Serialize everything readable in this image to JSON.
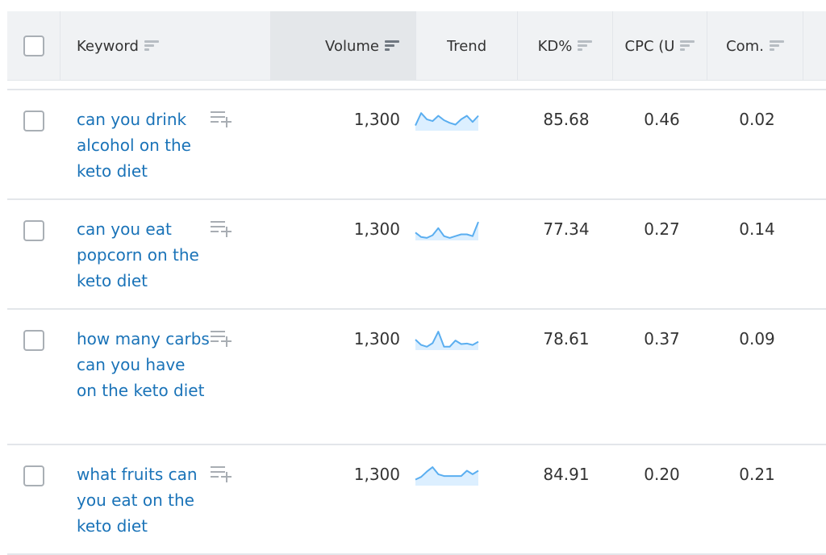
{
  "header": {
    "select_all_checked": false,
    "columns": [
      {
        "key": "keyword",
        "label": "Keyword",
        "sortable": true,
        "sorted": false
      },
      {
        "key": "volume",
        "label": "Volume",
        "sortable": true,
        "sorted": true
      },
      {
        "key": "trend",
        "label": "Trend",
        "sortable": false,
        "sorted": false
      },
      {
        "key": "kd",
        "label": "KD%",
        "sortable": true,
        "sorted": false
      },
      {
        "key": "cpc",
        "label": "CPC (U",
        "sortable": true,
        "sorted": false
      },
      {
        "key": "com",
        "label": "Com.",
        "sortable": true,
        "sorted": false
      }
    ]
  },
  "icons": {
    "sort": "sort-lines-icon",
    "add_to_list": "playlist-add-icon",
    "checkbox": "checkbox-icon"
  },
  "colors": {
    "link": "#1a73b8",
    "trend_line": "#5aaef0",
    "trend_fill": "#dcefff",
    "header_bg": "#f0f2f4",
    "sorted_header_bg": "#e4e7ea"
  },
  "rows": [
    {
      "keyword": "can you drink alcohol on the keto diet",
      "keyword_lines": [
        "can you drink",
        "alcohol on the",
        "keto diet"
      ],
      "volume": "1,300",
      "trend": [
        0.2,
        0.9,
        0.55,
        0.45,
        0.75,
        0.5,
        0.35,
        0.25,
        0.55,
        0.75,
        0.4,
        0.75
      ],
      "kd": "85.68",
      "cpc": "0.46",
      "com": "0.02",
      "checked": false
    },
    {
      "keyword": "can you eat popcorn on the keto diet",
      "keyword_lines": [
        "can you eat",
        "popcorn on the",
        "keto diet"
      ],
      "volume": "1,300",
      "trend": [
        0.35,
        0.1,
        0.05,
        0.2,
        0.6,
        0.15,
        0.05,
        0.15,
        0.25,
        0.25,
        0.15,
        0.95
      ],
      "kd": "77.34",
      "cpc": "0.27",
      "com": "0.14",
      "checked": false
    },
    {
      "keyword": "how many carbs can you have on the keto diet",
      "keyword_lines": [
        "how many",
        "carbs can you",
        "have on the",
        "keto diet"
      ],
      "volume": "1,300",
      "trend": [
        0.5,
        0.2,
        0.1,
        0.3,
        0.95,
        0.1,
        0.1,
        0.45,
        0.25,
        0.28,
        0.2,
        0.38
      ],
      "kd": "78.61",
      "cpc": "0.37",
      "com": "0.09",
      "checked": false
    },
    {
      "keyword": "what fruits can you eat on the keto diet",
      "keyword_lines": [
        "what fruits can",
        "you eat on the",
        "keto diet"
      ],
      "volume": "1,300",
      "trend": [
        0.25,
        0.4,
        0.7,
        0.95,
        0.55,
        0.45,
        0.45,
        0.45,
        0.45,
        0.75,
        0.55,
        0.75
      ],
      "kd": "84.91",
      "cpc": "0.20",
      "com": "0.21",
      "checked": false
    }
  ]
}
